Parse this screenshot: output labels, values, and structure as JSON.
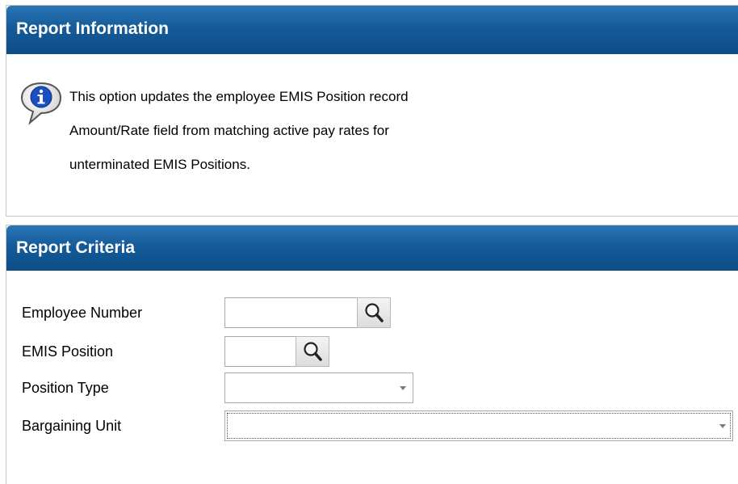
{
  "report_information": {
    "title": "Report Information",
    "lines": [
      "This option updates the employee EMIS Position record",
      "Amount/Rate field from matching active pay rates for",
      "unterminated EMIS Positions."
    ]
  },
  "report_criteria": {
    "title": "Report Criteria",
    "employee_number": {
      "label": "Employee Number",
      "value": ""
    },
    "emis_position": {
      "label": "EMIS Position",
      "value": ""
    },
    "position_type": {
      "label": "Position Type",
      "value": ""
    },
    "bargaining_unit": {
      "label": "Bargaining Unit",
      "value": ""
    }
  },
  "colors": {
    "header_top": "#2b76b5",
    "header_bottom": "#0d4c86",
    "header_text": "#ffffff"
  },
  "icons": {
    "info": "info-speech-bubble-icon",
    "lookup": "magnifier-icon",
    "dropdown": "chevron-down-icon"
  }
}
